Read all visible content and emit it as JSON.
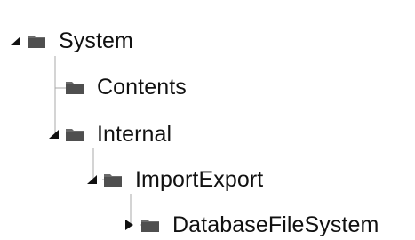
{
  "tree": {
    "nodes": [
      {
        "label": "System",
        "toggle": "expanded",
        "icon": "folder-icon"
      },
      {
        "label": "Contents",
        "toggle": "none",
        "icon": "folder-icon"
      },
      {
        "label": "Internal",
        "toggle": "expanded",
        "icon": "folder-icon"
      },
      {
        "label": "ImportExport",
        "toggle": "expanded",
        "icon": "folder-icon"
      },
      {
        "label": "DatabaseFileSystem",
        "toggle": "collapsed",
        "icon": "folder-icon"
      }
    ]
  },
  "colors": {
    "text": "#111111",
    "folder": "#6b6b6b",
    "folder_dark": "#4f4f4f",
    "connector": "#a8a8a8",
    "toggle": "#111111",
    "background": "#ffffff"
  }
}
